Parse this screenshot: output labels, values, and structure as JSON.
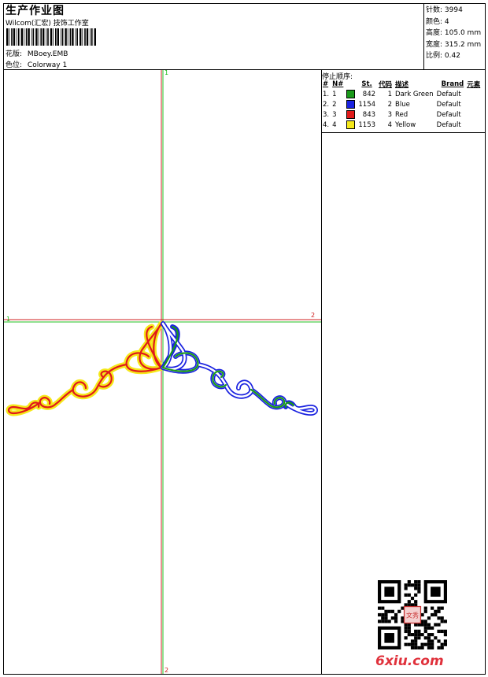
{
  "header": {
    "title": "生产作业图",
    "subtitle": "Wilcom(汇宏) 技饰工作室",
    "design_label": "花版:",
    "design_value": "MBoey.EMB",
    "colorway_label": "色位:",
    "colorway_value": "Colorway 1"
  },
  "stats": [
    {
      "label": "针数:",
      "value": "3994"
    },
    {
      "label": "颜色:",
      "value": "4"
    },
    {
      "label": "高度:",
      "value": "105.0 mm"
    },
    {
      "label": "宽度:",
      "value": "315.2 mm"
    },
    {
      "label": "比例:",
      "value": "0.42"
    }
  ],
  "stop_sequence": {
    "title": "停止顺序:",
    "columns": [
      "#",
      "N#",
      "St.",
      "代码",
      "描述",
      "Brand",
      "元素"
    ],
    "rows": [
      {
        "idx": "1.",
        "n": "1",
        "color": "#1a9a1a",
        "st": "842",
        "code": "1",
        "desc": "Dark Green",
        "brand": "Default",
        "elem": ""
      },
      {
        "idx": "2.",
        "n": "2",
        "color": "#1a22e0",
        "st": "1154",
        "code": "2",
        "desc": "Blue",
        "brand": "Default",
        "elem": ""
      },
      {
        "idx": "3.",
        "n": "3",
        "color": "#e01a1a",
        "st": "843",
        "code": "3",
        "desc": "Red",
        "brand": "Default",
        "elem": ""
      },
      {
        "idx": "4.",
        "n": "4",
        "color": "#f5e81a",
        "st": "1153",
        "code": "4",
        "desc": "Yellow",
        "brand": "Default",
        "elem": ""
      }
    ]
  },
  "axes": {
    "v_top": "1",
    "v_bottom": "2",
    "h_left": "1",
    "h_right": "2"
  },
  "watermark": "6xiu.com",
  "qr_seal": "文秀",
  "colors": {
    "green": "#1a9a1a",
    "blue": "#1a22e0",
    "red": "#e01a1a",
    "yellow": "#f5e81a",
    "axis_red": "#d02020",
    "axis_green": "#20c020"
  }
}
